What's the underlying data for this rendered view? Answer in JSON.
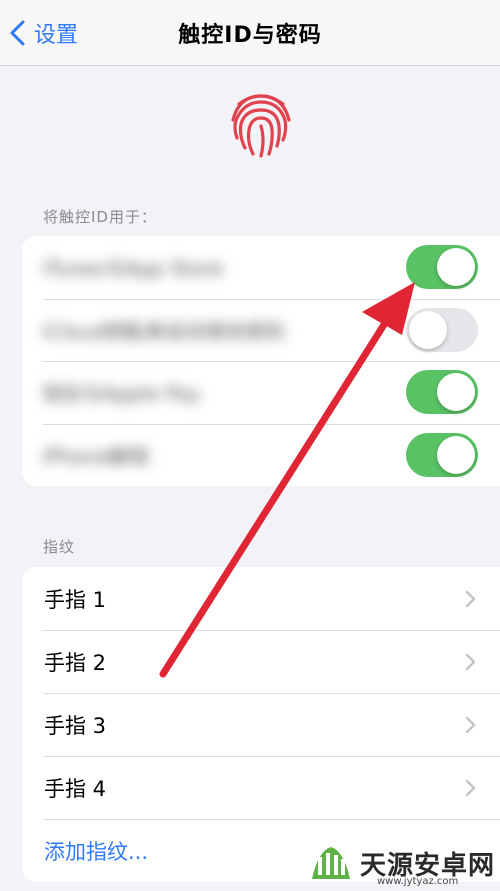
{
  "navbar": {
    "back_label": "设置",
    "title": "触控ID与密码"
  },
  "touchid_section": {
    "header": "将触控ID用于：",
    "items": [
      {
        "label": "iTunes与App Store",
        "on": true
      },
      {
        "label": "iCloud钥匙串自动填充密码",
        "on": false
      },
      {
        "label": "钱包与Apple Pay",
        "on": true
      },
      {
        "label": "iPhone解锁",
        "on": true
      }
    ]
  },
  "fingerprint_section": {
    "header": "指纹",
    "fingers": [
      "手指 1",
      "手指 2",
      "手指 3",
      "手指 4"
    ],
    "add_label": "添加指纹..."
  },
  "watermark": {
    "text": "天源安卓网",
    "url": "www.jytyaz.com"
  },
  "colors": {
    "accent": "#2f7bf5",
    "toggle_on": "#59c264",
    "fingerprint": "#e0434d",
    "arrow": "#e02535"
  },
  "icons": [
    "chevron-left-icon",
    "fingerprint-icon",
    "chevron-right-icon",
    "watermark-logo-icon"
  ]
}
